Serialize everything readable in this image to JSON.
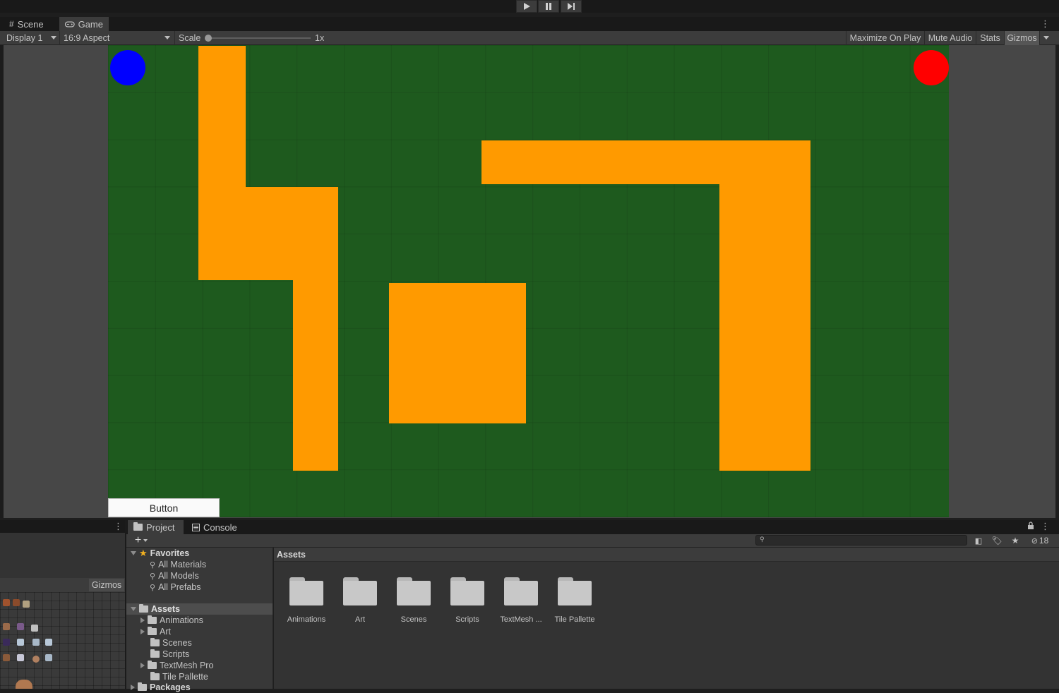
{
  "toolbar": {
    "play_icon": "play-icon",
    "pause_icon": "pause-icon",
    "step_icon": "step-icon"
  },
  "tabs": [
    {
      "label": "Scene",
      "icon": "grid-icon"
    },
    {
      "label": "Game",
      "icon": "gamepad-icon"
    }
  ],
  "gamebar": {
    "display": "Display 1",
    "aspect": "16:9 Aspect",
    "scale_label": "Scale",
    "scale_value": "1x",
    "scale_fraction": 0,
    "maximize": "Maximize On Play",
    "mute": "Mute Audio",
    "stats": "Stats",
    "gizmos": "Gizmos"
  },
  "game": {
    "background_color": "#1e5a1e",
    "wall_color": "#ff9a00",
    "player_colors": {
      "blue": "#0000ff",
      "red": "#ff0000"
    },
    "button_label": "Button"
  },
  "lower_left": {
    "gizmos": "Gizmos"
  },
  "project": {
    "tabs": [
      "Project",
      "Console"
    ],
    "hidden_count": "18",
    "tree": {
      "favorites_label": "Favorites",
      "favorites": [
        "All Materials",
        "All Models",
        "All Prefabs"
      ],
      "assets_label": "Assets",
      "assets_children": [
        "Animations",
        "Art",
        "Scenes",
        "Scripts",
        "TextMesh Pro",
        "Tile Pallette"
      ],
      "packages_label": "Packages"
    },
    "breadcrumb": "Assets",
    "folders": [
      "Animations",
      "Art",
      "Scenes",
      "Scripts",
      "TextMesh ...",
      "Tile Pallette"
    ]
  }
}
